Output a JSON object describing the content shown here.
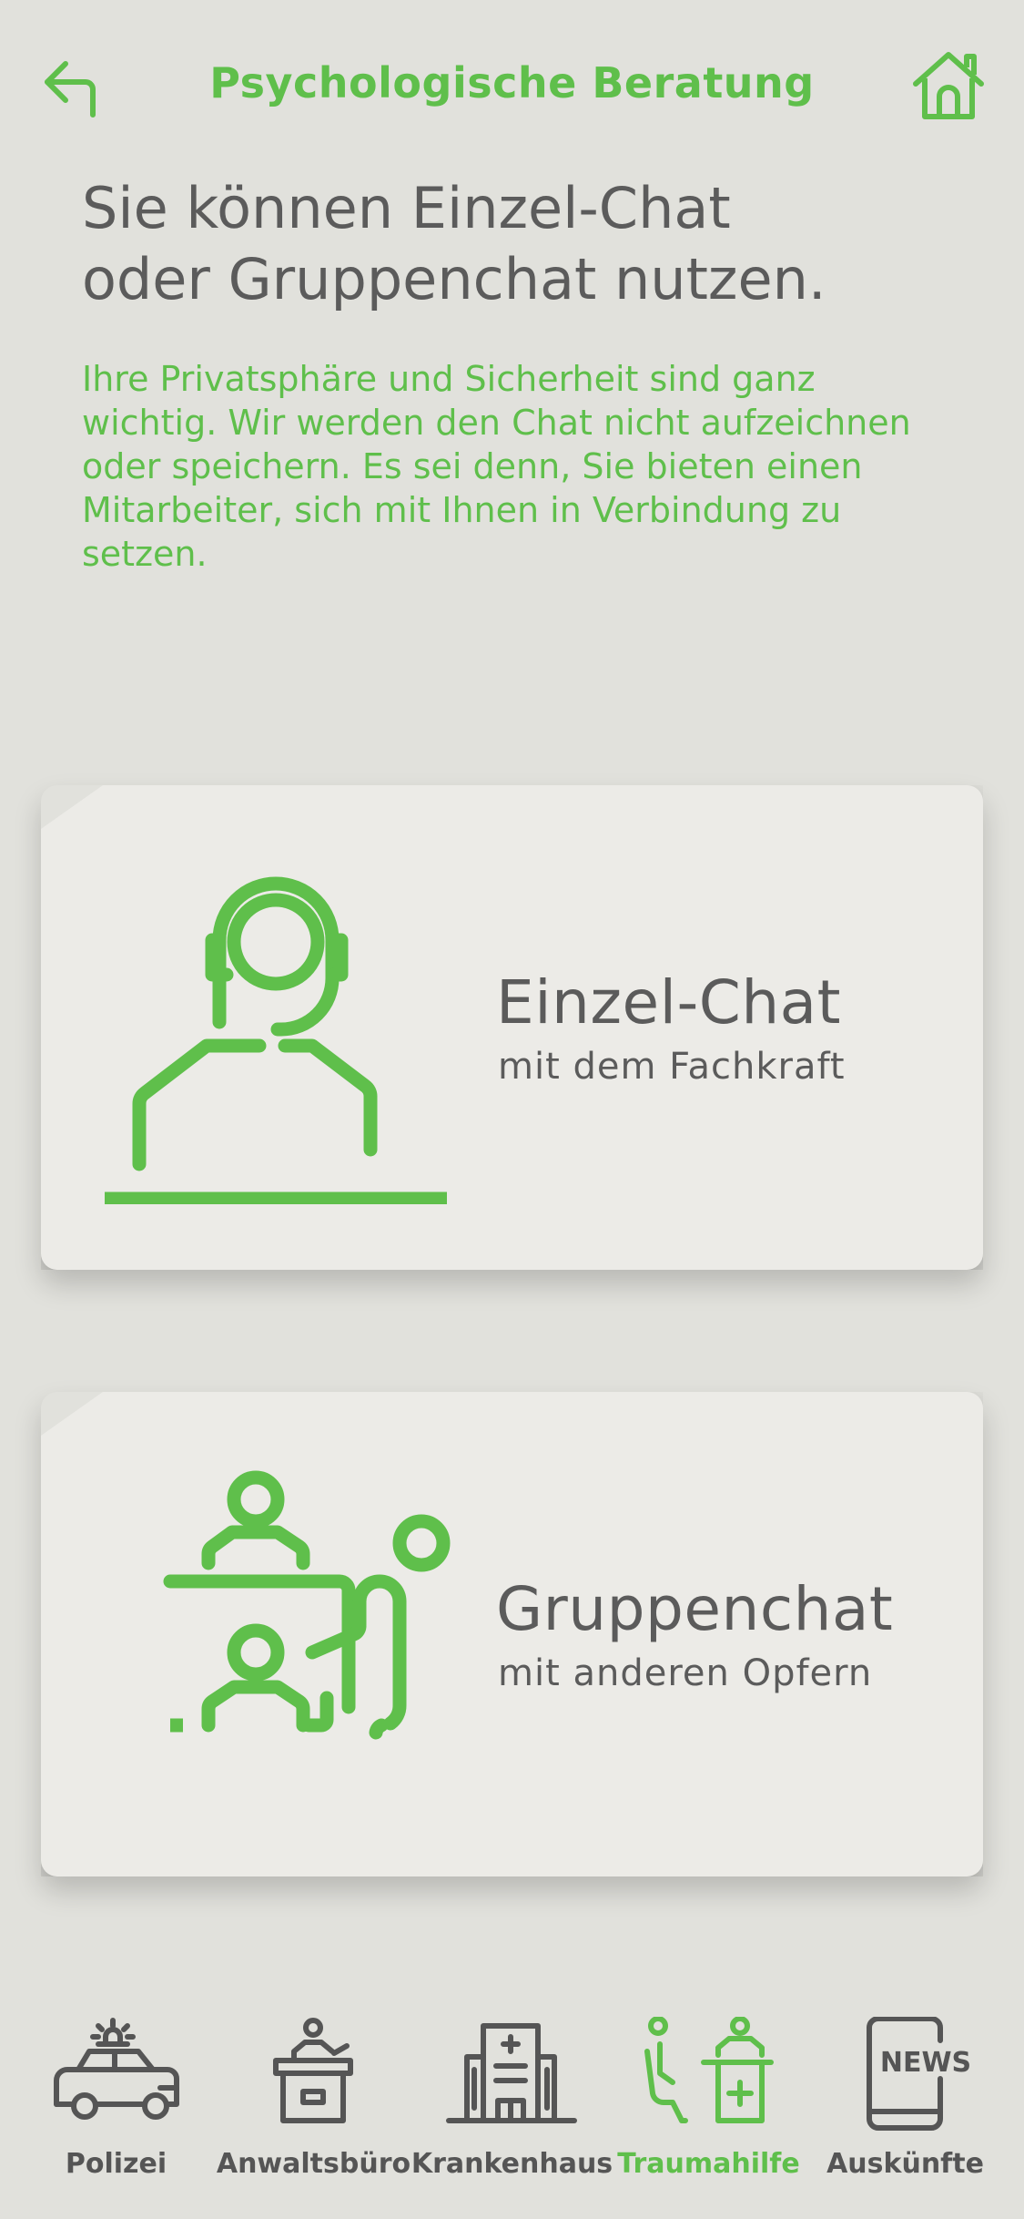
{
  "colors": {
    "accent": "#5fbf4b",
    "text": "#5b5b5b",
    "background": "#e1e1dc",
    "card": "#ecebe7"
  },
  "header": {
    "title": "Psychologische Beratung",
    "back_icon": "back-arrow-icon",
    "home_icon": "home-icon"
  },
  "headline": "Sie können Einzel-Chat\noder Gruppenchat nutzen.",
  "intro": "Ihre Privatsphäre und Sicherheit sind ganz wichtig. Wir werden den Chat nicht aufzeichnen oder speichern. Es sei denn, Sie bieten einen Mitarbeiter, sich mit Ihnen in Verbindung zu setzen.",
  "options": [
    {
      "title": "Einzel-Chat",
      "subtitle": "mit dem Fachkraft",
      "icon": "counselor-headset-icon"
    },
    {
      "title": "Gruppenchat",
      "subtitle": "mit anderen Opfern",
      "icon": "group-meeting-icon"
    }
  ],
  "tabs": [
    {
      "label": "Polizei",
      "icon": "police-car-icon",
      "active": false
    },
    {
      "label": "Anwaltsbüro",
      "icon": "lawyer-podium-icon",
      "active": false
    },
    {
      "label": "Krankenhaus",
      "icon": "hospital-icon",
      "active": false
    },
    {
      "label": "Traumahilfe",
      "icon": "trauma-help-icon",
      "active": true
    },
    {
      "label": "Auskünfte",
      "icon": "news-phone-icon",
      "active": false,
      "icon_text": "NEWS"
    }
  ]
}
